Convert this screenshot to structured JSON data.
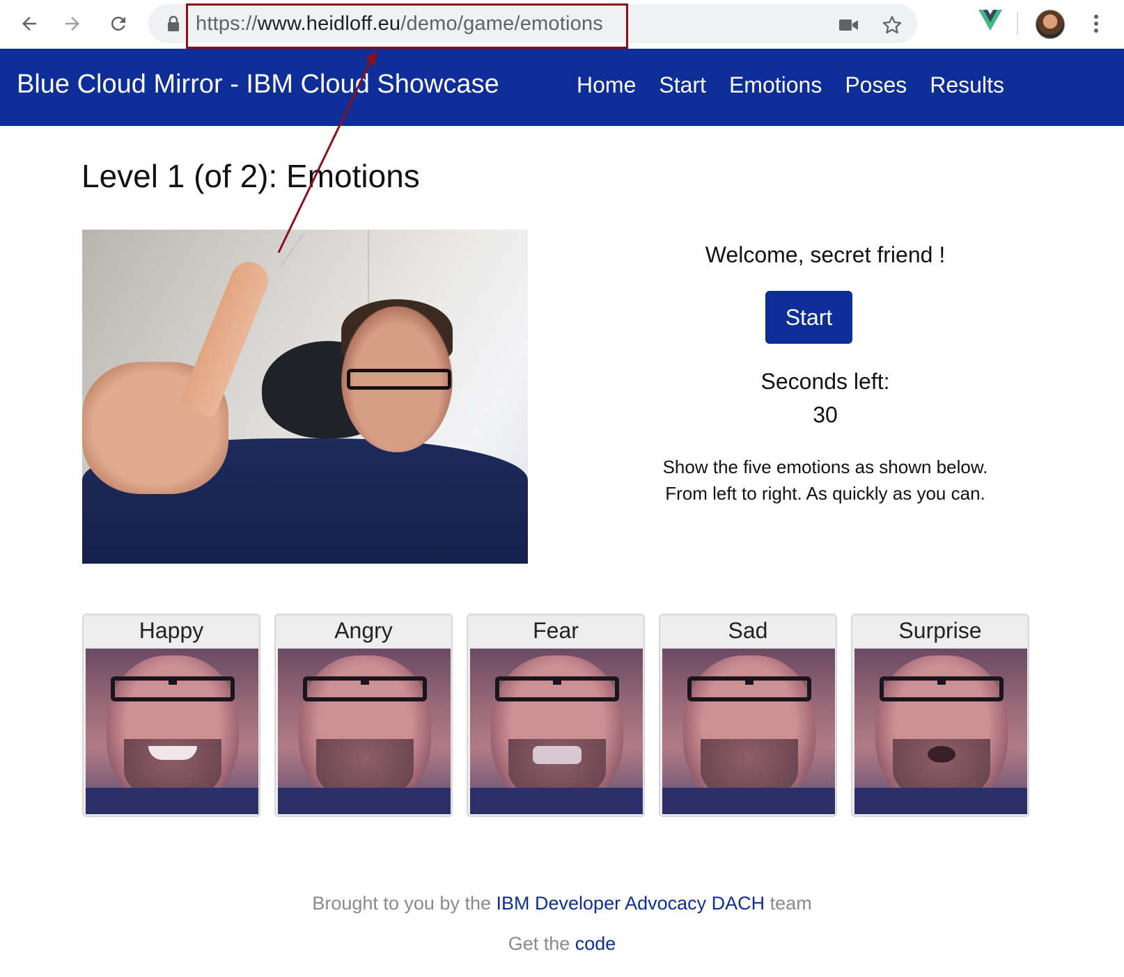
{
  "browser": {
    "url_scheme": "https://",
    "url_host": "www.heidloff.eu",
    "url_path": "/demo/game/emotions",
    "icons": [
      "back-arrow-icon",
      "forward-arrow-icon",
      "reload-icon",
      "lock-icon",
      "camera-icon",
      "star-icon",
      "vue-extension-icon",
      "avatar",
      "more-vert-icon"
    ]
  },
  "navbar": {
    "brand": "Blue Cloud Mirror - IBM Cloud Showcase",
    "links": [
      "Home",
      "Start",
      "Emotions",
      "Poses",
      "Results"
    ],
    "color": "#0c2e96"
  },
  "page": {
    "title": "Level 1 (of 2): Emotions"
  },
  "panel": {
    "welcome": "Welcome, secret friend !",
    "start_button": "Start",
    "seconds_label": "Seconds left:",
    "seconds_value": "30",
    "instructions_line1": "Show the five emotions as shown below.",
    "instructions_line2": "From left to right. As quickly as you can."
  },
  "emotions": [
    {
      "label": "Happy"
    },
    {
      "label": "Angry"
    },
    {
      "label": "Fear"
    },
    {
      "label": "Sad"
    },
    {
      "label": "Surprise"
    }
  ],
  "footer": {
    "line1_prefix": "Brought to you by the ",
    "line1_link": "IBM Developer Advocacy DACH",
    "line1_suffix": " team",
    "line2_prefix": "Get the ",
    "line2_link": "code"
  },
  "colors": {
    "annotation": "#8b0f14",
    "link": "#0c2e96"
  }
}
